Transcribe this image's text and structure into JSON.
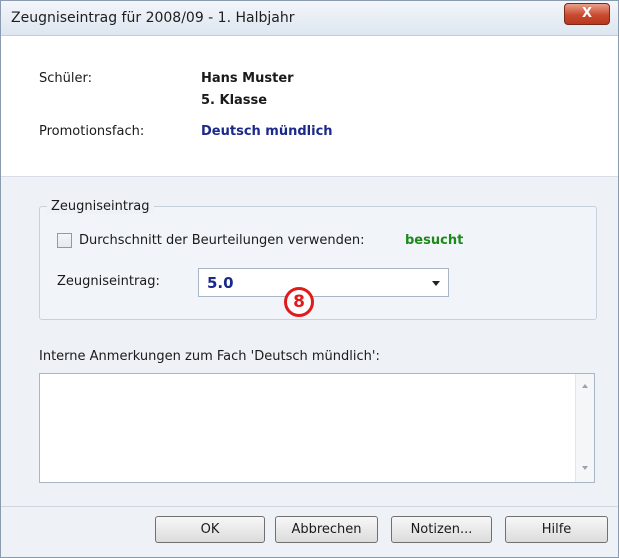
{
  "window": {
    "title": "Zeugniseintrag für 2008/09 - 1. Halbjahr",
    "close_label": "X"
  },
  "student": {
    "label": "Schüler:",
    "name": "Hans Muster",
    "class": "5. Klasse"
  },
  "subject": {
    "label": "Promotionsfach:",
    "value": "Deutsch mündlich"
  },
  "group": {
    "title": "Zeugniseintrag",
    "checkbox_label": "Durchschnitt der Beurteilungen verwenden:",
    "checkbox_checked": false,
    "status": "besucht",
    "field_label": "Zeugniseintrag:",
    "field_value": "5.0"
  },
  "annotation_marker": "8",
  "notes": {
    "label": "Interne Anmerkungen zum Fach 'Deutsch mündlich':",
    "value": ""
  },
  "buttons": {
    "ok": "OK",
    "cancel": "Abbrechen",
    "notes": "Notizen...",
    "help": "Hilfe"
  },
  "colors": {
    "accent_blue": "#1a2a8a",
    "status_green": "#1b8a1b",
    "marker_red": "#e01b1b"
  }
}
